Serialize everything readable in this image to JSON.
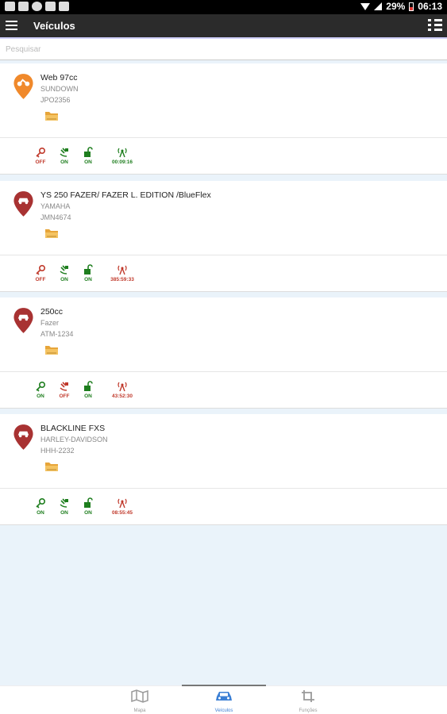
{
  "status_bar": {
    "battery": "29%",
    "time": "06:13"
  },
  "app_bar": {
    "title": "Veículos"
  },
  "search": {
    "placeholder": "Pesquisar"
  },
  "vehicles": [
    {
      "name": "Web 97cc",
      "brand": "SUNDOWN",
      "plate": "JPO2356",
      "pin_color": "#f0892b",
      "statuses": [
        {
          "label": "OFF",
          "color": "red"
        },
        {
          "label": "ON",
          "color": "green"
        },
        {
          "label": "ON",
          "color": "green"
        },
        {
          "label": "00:09:16",
          "color": "green"
        }
      ]
    },
    {
      "name": "YS 250 FAZER/ FAZER L. EDITION /BlueFlex",
      "brand": "YAMAHA",
      "plate": "JMN4674",
      "pin_color": "#a83232",
      "statuses": [
        {
          "label": "OFF",
          "color": "red"
        },
        {
          "label": "ON",
          "color": "green"
        },
        {
          "label": "ON",
          "color": "green"
        },
        {
          "label": "385:59:33",
          "color": "red"
        }
      ]
    },
    {
      "name": "250cc",
      "brand": "Fazer",
      "plate": "ATM-1234",
      "pin_color": "#a83232",
      "statuses": [
        {
          "label": "ON",
          "color": "green"
        },
        {
          "label": "OFF",
          "color": "red"
        },
        {
          "label": "ON",
          "color": "green"
        },
        {
          "label": "43:52:30",
          "color": "red"
        }
      ]
    },
    {
      "name": "BLACKLINE FXS",
      "brand": "HARLEY-DAVIDSON",
      "plate": "HHH-2232",
      "pin_color": "#a83232",
      "statuses": [
        {
          "label": "ON",
          "color": "green"
        },
        {
          "label": "ON",
          "color": "green"
        },
        {
          "label": "ON",
          "color": "green"
        },
        {
          "label": "08:55:45",
          "color": "red"
        }
      ]
    }
  ],
  "bottom_nav": [
    {
      "label": "Mapa",
      "icon": "map-icon",
      "active": false
    },
    {
      "label": "Veículos",
      "icon": "car-icon",
      "active": true
    },
    {
      "label": "Funções",
      "icon": "crop-icon",
      "active": false
    }
  ],
  "colors": {
    "app_bar": "#2b2b2b",
    "background": "#eaf3fa",
    "active_nav": "#3b7fd4",
    "status_on": "#1e7e1e",
    "status_off": "#c0392b"
  }
}
